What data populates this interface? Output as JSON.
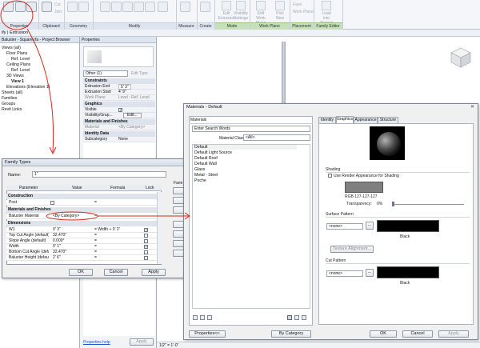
{
  "ribbon": {
    "clipboard_label": "Clipboard",
    "geometry_label": "Geometry",
    "properties_label": "Properties",
    "modify_label": "Modify",
    "measure_label": "Measure",
    "create_label": "Create",
    "mode_label": "Mode",
    "workplane_label": "Work Plane",
    "placement_label": "Placement",
    "family_editor_label": "Family Editor",
    "cut_label": "Cut",
    "join_label": "Join",
    "edit_extrusion_label": "Edit Extrusion",
    "visibility_settings_label": "Visibility Settings",
    "edit_work_plane_label": "Edit Work Plane",
    "pick_new_label": "Pick New",
    "face_label": "Face",
    "work_plane_btn_label": "Work Plane",
    "load_into_project_label": "Load into Project"
  },
  "tabstrip": {
    "title": "ify | Extrusion"
  },
  "browser": {
    "title": "Baluster - Square.rfa - Project Browser",
    "items": [
      "Views (all)",
      "Floor Plans",
      "Ref. Level",
      "Ceiling Plans",
      "Ref. Level",
      "3D Views",
      "View 1",
      "Elevations (Elevation 1)",
      "Sheets (all)",
      "Families",
      "Groups",
      "Revit Links"
    ]
  },
  "properties": {
    "title": "Properties",
    "type_selector": "Other (1)",
    "edit_type": "Edit Type",
    "sections": {
      "constraints": "Constraints",
      "graphics": "Graphics",
      "materials": "Materials and Finishes",
      "identity": "Identity Data"
    },
    "rows": {
      "extrusion_end_label": "Extrusion End",
      "extrusion_end_value": "5'  3\"",
      "extrusion_start_label": "Extrusion Start",
      "extrusion_start_value": "4'  9\"",
      "work_plane_label": "Work Plane",
      "work_plane_value": "Level : Ref. Level",
      "visible_label": "Visible",
      "vis_grap_label": "Visibility/Grap...",
      "vis_grap_value": "Edit...",
      "material_label": "Material",
      "material_value": "<By Category>",
      "subcategory_label": "Subcategory",
      "subcategory_value": "None"
    },
    "help_link": "Properties help",
    "apply": "Apply"
  },
  "family_types": {
    "title": "Family Types",
    "name_label": "Name:",
    "name_value": "1\"",
    "headers": {
      "parameter": "Parameter",
      "value": "Value",
      "formula": "Formula",
      "lock": "Lock",
      "family_types": "Family Types"
    },
    "construction": "Construction",
    "post_label": "Post",
    "materials_section": "Materials and Finishes",
    "baluster_material_label": "Baluster Material",
    "baluster_material_value": "<By Category>",
    "dimensions": "Dimensions",
    "rows": [
      {
        "param": "W1",
        "value": "0'  3\"",
        "formula": "= Width + 0'  2\"",
        "lock": true
      },
      {
        "param": "Top Cut Angle (default)",
        "value": "32.470°",
        "formula": "=",
        "lock": false
      },
      {
        "param": "Slope Angle (default)",
        "value": "0.000°",
        "formula": "=",
        "lock": false
      },
      {
        "param": "Width",
        "value": "0'  1\"",
        "formula": "=",
        "lock": true
      },
      {
        "param": "Bottom Cut Angle (default)",
        "value": "32.470°",
        "formula": "=",
        "lock": false
      },
      {
        "param": "Baluster Height (default)",
        "value": "2'  6\"",
        "formula": "=",
        "lock": false
      }
    ],
    "side_buttons": [
      "",
      "",
      "",
      "",
      "",
      "",
      ""
    ],
    "ok": "OK",
    "cancel": "Cancel",
    "apply": "Apply",
    "family_label": "Fami"
  },
  "materials": {
    "title": "Materials - Default",
    "list_header": "Materials",
    "search_placeholder": "Enter Search Words",
    "class_label": "Material Class:",
    "class_value": "<All>",
    "items": [
      "Default",
      "Default Light Source",
      "Default Roof",
      "Default Wall",
      "Glass",
      "Metal - Steel",
      "Poche"
    ],
    "tabs": [
      "Identity",
      "Graphics",
      "Appearance",
      "Structure"
    ],
    "shading_title": "Shading",
    "use_render_label": "Use Render Appearance for Shading",
    "rgb_label": "RGB 127-127-127",
    "transparency_label": "Transparency:",
    "transparency_value": "0%",
    "surface_pattern_title": "Surface Pattern",
    "surface_pattern_value": "<none>",
    "surface_color_label": "Black",
    "texture_alignment": "Texture Alignment...",
    "cut_pattern_title": "Cut Pattern",
    "cut_pattern_value": "<none>",
    "cut_color_label": "Black",
    "properties_btn": "Properties<<",
    "by_category_btn": "By Category",
    "ok": "OK",
    "cancel": "Cancel",
    "apply": "Apply",
    "shading_color": "#7f7f7f",
    "pattern_color": "#000000"
  },
  "view_scale": "1/2\" = 1'-0\"",
  "annotation_color": "#d42a20"
}
